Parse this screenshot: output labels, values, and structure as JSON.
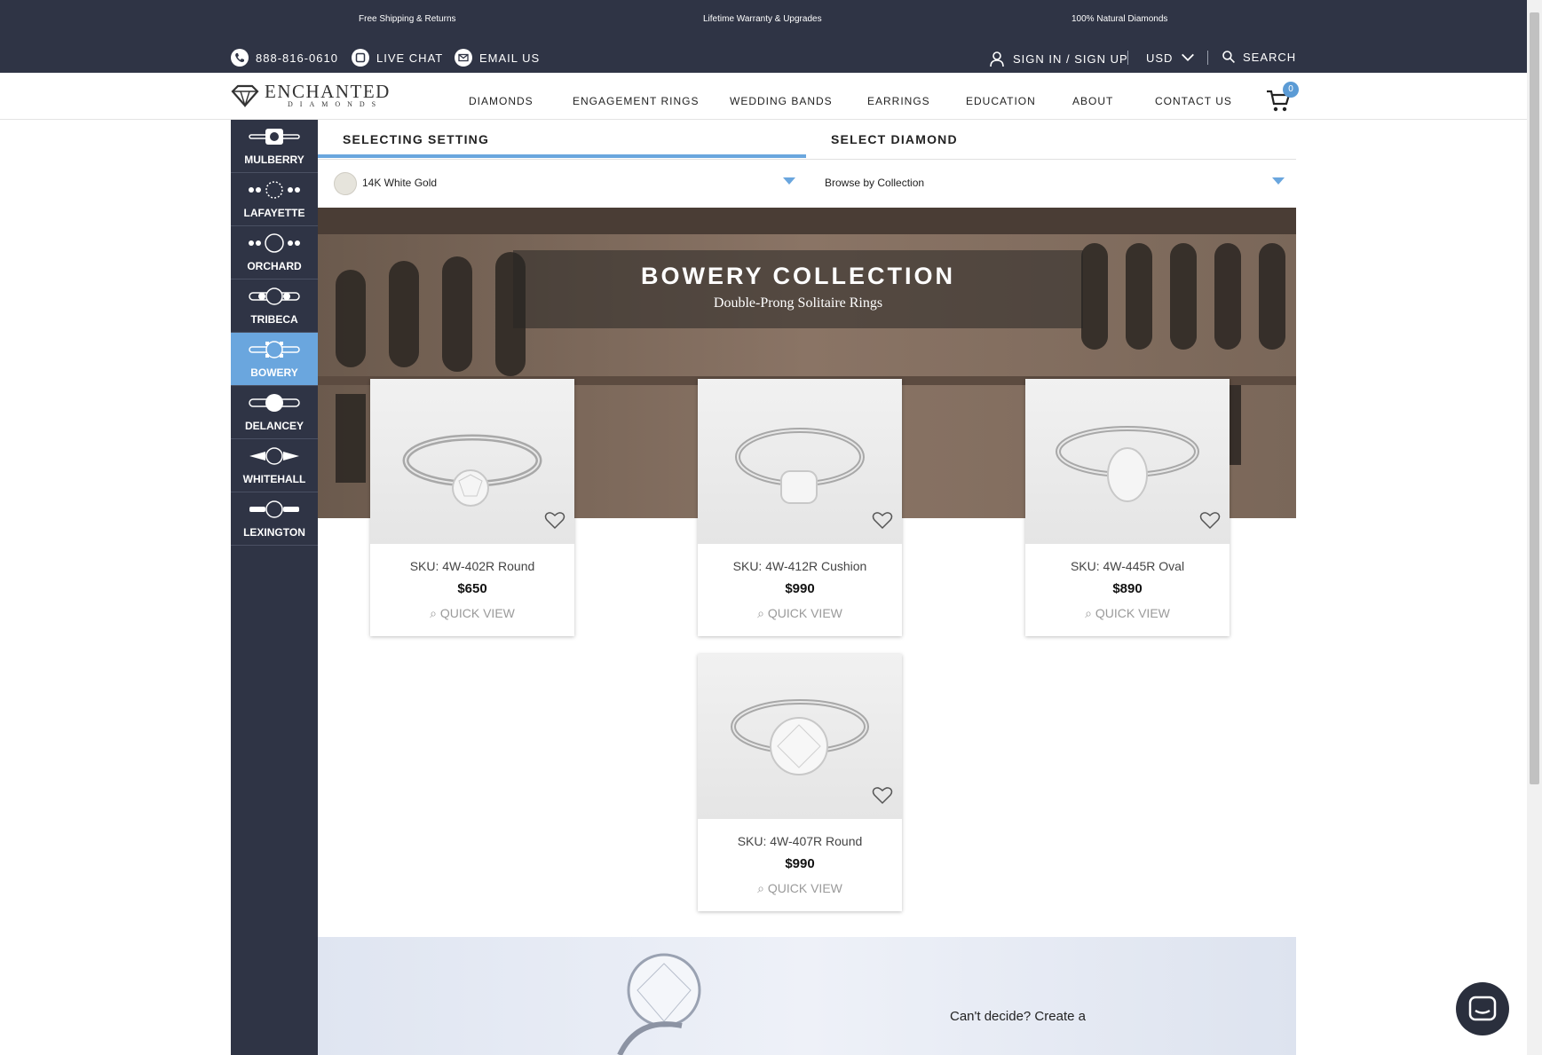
{
  "promos": [
    "Free Shipping & Returns",
    "Lifetime Warranty & Upgrades",
    "100% Natural Diamonds"
  ],
  "utility": {
    "phone": "888-816-0610",
    "live_chat": "LIVE CHAT",
    "email": "EMAIL US",
    "sign_in": "SIGN IN / SIGN UP",
    "currency": "USD",
    "search": "SEARCH"
  },
  "brand": {
    "name": "ENCHANTED",
    "sub": "DIAMONDS"
  },
  "nav": [
    "DIAMONDS",
    "ENGAGEMENT RINGS",
    "WEDDING BANDS",
    "EARRINGS",
    "EDUCATION",
    "ABOUT",
    "CONTACT US"
  ],
  "cart_count": "0",
  "collections": [
    {
      "label": "MULBERRY",
      "icon": "mulberry-ring-icon"
    },
    {
      "label": "LAFAYETTE",
      "icon": "lafayette-ring-icon"
    },
    {
      "label": "ORCHARD",
      "icon": "orchard-ring-icon"
    },
    {
      "label": "TRIBECA",
      "icon": "tribeca-ring-icon"
    },
    {
      "label": "BOWERY",
      "icon": "bowery-ring-icon",
      "active": true
    },
    {
      "label": "DELANCEY",
      "icon": "delancey-ring-icon"
    },
    {
      "label": "WHITEHALL",
      "icon": "whitehall-ring-icon"
    },
    {
      "label": "LEXINGTON",
      "icon": "lexington-ring-icon"
    }
  ],
  "tabs": {
    "setting": "SELECTING SETTING",
    "diamond": "SELECT DIAMOND"
  },
  "filters": {
    "metal": "14K White Gold",
    "browse": "Browse by Collection"
  },
  "hero": {
    "title": "BOWERY COLLECTION",
    "subtitle": "Double-Prong Solitaire Rings"
  },
  "products": [
    {
      "sku": "SKU: 4W-402R Round",
      "price": "$650",
      "quick_view": "QUICK VIEW"
    },
    {
      "sku": "SKU: 4W-412R Cushion",
      "price": "$990",
      "quick_view": "QUICK VIEW"
    },
    {
      "sku": "SKU: 4W-445R Oval",
      "price": "$890",
      "quick_view": "QUICK VIEW"
    },
    {
      "sku": "SKU: 4W-407R Round",
      "price": "$990",
      "quick_view": "QUICK VIEW"
    }
  ],
  "banner": {
    "text": "Can't decide? Create a"
  },
  "colors": {
    "navy": "#2f3445",
    "accent": "#6aa6de"
  }
}
